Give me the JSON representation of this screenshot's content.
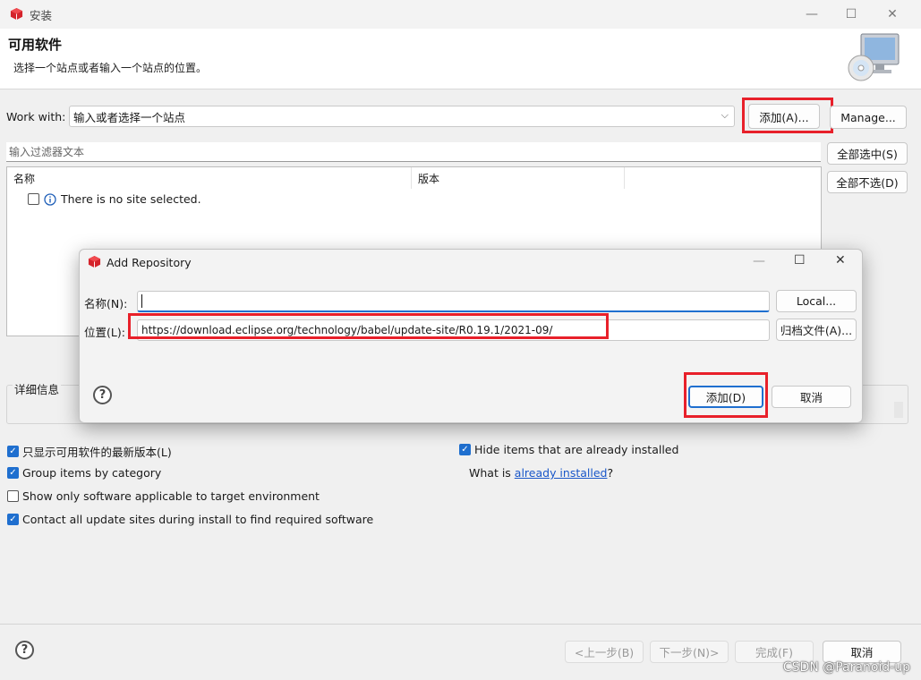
{
  "window": {
    "title": "安装"
  },
  "header": {
    "title": "可用软件",
    "description": "选择一个站点或者输入一个站点的位置。"
  },
  "work_with": {
    "label": "Work with:",
    "value": "输入或者选择一个站点",
    "add_label": "添加(A)...",
    "manage_label": "Manage..."
  },
  "filter": {
    "placeholder": "输入过滤器文本"
  },
  "side_buttons": {
    "select_all": "全部选中(S)",
    "deselect_all": "全部不选(D)"
  },
  "table": {
    "columns": [
      "名称",
      "版本"
    ],
    "empty_message": "There is no site selected."
  },
  "details": {
    "label": "详细信息"
  },
  "options": [
    {
      "label": "只显示可用软件的最新版本(L)",
      "checked": true
    },
    {
      "label": "Group items by category",
      "checked": true
    },
    {
      "label": "Show only software applicable to target environment",
      "checked": false
    },
    {
      "label": "Contact all update sites during install to find required software",
      "checked": true
    }
  ],
  "right_options": {
    "hide_installed": {
      "label": "Hide items that are already installed",
      "checked": true
    },
    "what_is_prefix": "What is ",
    "what_is_link": "already installed",
    "what_is_suffix": "?"
  },
  "footer": {
    "back": "<上一步(B)",
    "next": "下一步(N)>",
    "finish": "完成(F)",
    "cancel": "取消"
  },
  "dialog": {
    "title": "Add Repository",
    "name_label": "名称(N):",
    "name_value": "",
    "local_label": "Local...",
    "location_label": "位置(L):",
    "location_value": "https://download.eclipse.org/technology/babel/update-site/R0.19.1/2021-09/",
    "archive_label": "归档文件(A)...",
    "add_label": "添加(D)",
    "cancel_label": "取消"
  },
  "watermark": "CSDN @Paranoid-up",
  "colors": {
    "highlight": "#e8202a",
    "accent": "#1f6fcf",
    "link": "#1a57c9"
  }
}
